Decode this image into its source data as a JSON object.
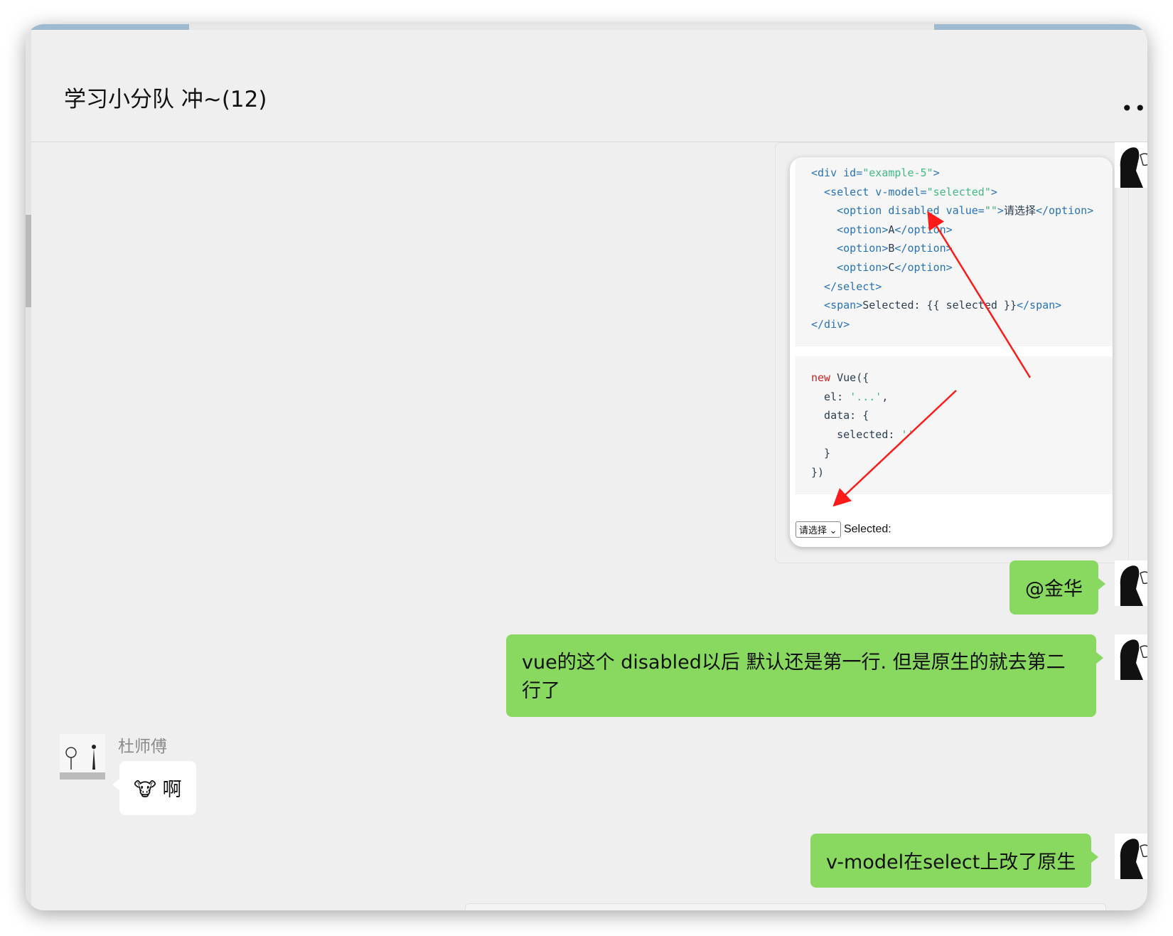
{
  "chat": {
    "title": "学习小分队 冲~(12)"
  },
  "header": {
    "more_glyph": "••"
  },
  "screenshot": {
    "code_html": [
      [
        {
          "t": "<div id=",
          "c": "tag"
        },
        {
          "t": "\"example-5\"",
          "c": "str"
        },
        {
          "t": ">",
          "c": "tag"
        }
      ],
      [
        {
          "t": "  <select v-model=",
          "c": "tag"
        },
        {
          "t": "\"selected\"",
          "c": "str"
        },
        {
          "t": ">",
          "c": "tag"
        }
      ],
      [
        {
          "t": "    <option disabled value=",
          "c": "tag"
        },
        {
          "t": "\"\"",
          "c": "str"
        },
        {
          "t": ">",
          "c": "tag"
        },
        {
          "t": "请选择",
          "c": "txt"
        },
        {
          "t": "</option>",
          "c": "tag"
        }
      ],
      [
        {
          "t": "    <option>",
          "c": "tag"
        },
        {
          "t": "A",
          "c": "txt"
        },
        {
          "t": "</option>",
          "c": "tag"
        }
      ],
      [
        {
          "t": "    <option>",
          "c": "tag"
        },
        {
          "t": "B",
          "c": "txt"
        },
        {
          "t": "</option>",
          "c": "tag"
        }
      ],
      [
        {
          "t": "    <option>",
          "c": "tag"
        },
        {
          "t": "C",
          "c": "txt"
        },
        {
          "t": "</option>",
          "c": "tag"
        }
      ],
      [
        {
          "t": "  </select>",
          "c": "tag"
        }
      ],
      [
        {
          "t": "  <span>",
          "c": "tag"
        },
        {
          "t": "Selected: {{ selected }}",
          "c": "txt"
        },
        {
          "t": "</span>",
          "c": "tag"
        }
      ],
      [
        {
          "t": "</div>",
          "c": "tag"
        }
      ]
    ],
    "code_js": [
      [
        {
          "t": "new",
          "c": "new"
        },
        {
          "t": " Vue({",
          "c": "txt"
        }
      ],
      [
        {
          "t": "  el: ",
          "c": "txt"
        },
        {
          "t": "'...'",
          "c": "str"
        },
        {
          "t": ",",
          "c": "txt"
        }
      ],
      [
        {
          "t": "  data: {",
          "c": "txt"
        }
      ],
      [
        {
          "t": "    selected: ",
          "c": "txt"
        },
        {
          "t": "''",
          "c": "str"
        }
      ],
      [
        {
          "t": "  }",
          "c": "txt"
        }
      ],
      [
        {
          "t": "})",
          "c": "txt"
        }
      ]
    ],
    "demo_select_value": "请选择",
    "demo_label": "Selected:"
  },
  "messages": [
    {
      "sender": "me",
      "text": "@金华"
    },
    {
      "sender": "me",
      "text": "vue的这个 disabled以后 默认还是第一行. 但是原生的就去第二行了"
    },
    {
      "sender": "杜师傅",
      "text": "🐮 啊"
    },
    {
      "sender": "me",
      "text": "v-model在select上改了原生"
    }
  ],
  "colors": {
    "my_bubble": "#89d961",
    "other_bubble": "#ffffff",
    "background": "#efefef",
    "arrow": "#ff1a1a"
  }
}
